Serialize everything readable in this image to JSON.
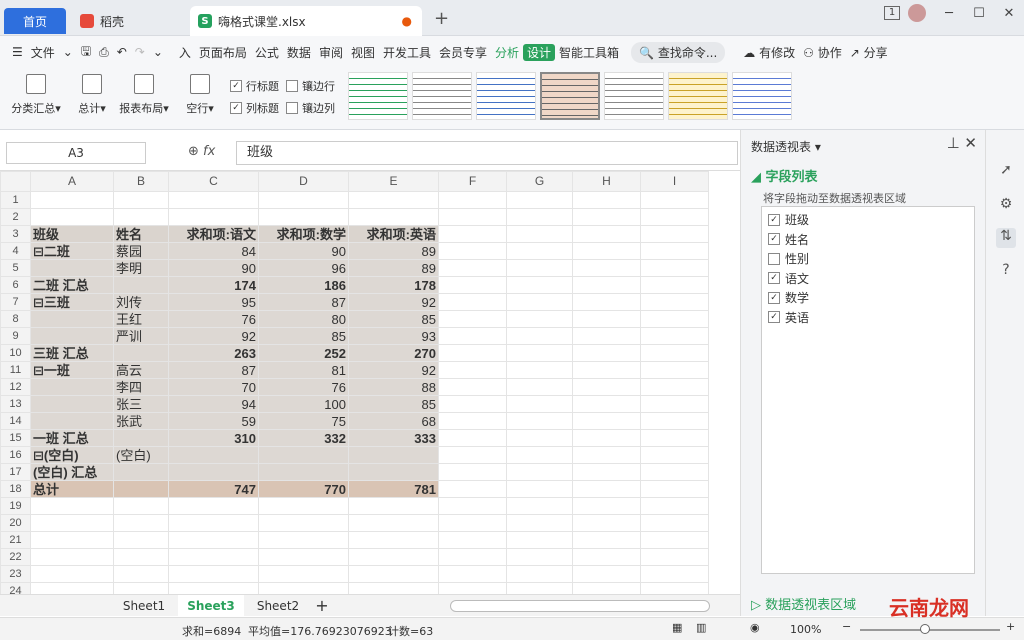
{
  "tabs": {
    "home": "首页",
    "daoke": "稻壳",
    "file": "嗨格式课堂.xlsx"
  },
  "window": {
    "page_indicator": "1"
  },
  "menu": [
    "文件",
    "入",
    "页面布局",
    "公式",
    "数据",
    "审阅",
    "视图",
    "开发工具",
    "会员专享",
    "分析",
    "设计",
    "智能工具箱"
  ],
  "menu_right": {
    "search": "查找命令...",
    "modified": "有修改",
    "collab": "协作",
    "share": "分享"
  },
  "ribbon": {
    "buttons": [
      "分类汇总",
      "总计",
      "报表布局",
      "空行"
    ],
    "checks": [
      {
        "label": "行标题",
        "checked": true
      },
      {
        "label": "镶边行",
        "checked": false
      },
      {
        "label": "列标题",
        "checked": true
      },
      {
        "label": "镶边列",
        "checked": false
      }
    ]
  },
  "formula": {
    "name_box": "A3",
    "fx": "fx",
    "value": "班级"
  },
  "columns": [
    "A",
    "B",
    "C",
    "D",
    "E",
    "F",
    "G",
    "H",
    "I"
  ],
  "rows": [
    {
      "n": "1",
      "c": [
        "",
        "",
        "",
        "",
        ""
      ],
      "t": "blank"
    },
    {
      "n": "2",
      "c": [
        "",
        "",
        "",
        "",
        ""
      ],
      "t": "blank"
    },
    {
      "n": "3",
      "c": [
        "班级",
        "姓名",
        "求和项:语文",
        "求和项:数学",
        "求和项:英语"
      ],
      "t": "header"
    },
    {
      "n": "4",
      "c": [
        "⊟二班",
        "蔡园",
        "84",
        "90",
        "89"
      ],
      "t": "data"
    },
    {
      "n": "5",
      "c": [
        "",
        "李明",
        "90",
        "96",
        "89"
      ],
      "t": "data"
    },
    {
      "n": "6",
      "c": [
        "二班 汇总",
        "",
        "174",
        "186",
        "178"
      ],
      "t": "sub"
    },
    {
      "n": "7",
      "c": [
        "⊟三班",
        "刘传",
        "95",
        "87",
        "92"
      ],
      "t": "data"
    },
    {
      "n": "8",
      "c": [
        "",
        "王红",
        "76",
        "80",
        "85"
      ],
      "t": "data"
    },
    {
      "n": "9",
      "c": [
        "",
        "严训",
        "92",
        "85",
        "93"
      ],
      "t": "data"
    },
    {
      "n": "10",
      "c": [
        "三班 汇总",
        "",
        "263",
        "252",
        "270"
      ],
      "t": "sub"
    },
    {
      "n": "11",
      "c": [
        "⊟一班",
        "高云",
        "87",
        "81",
        "92"
      ],
      "t": "data"
    },
    {
      "n": "12",
      "c": [
        "",
        "李四",
        "70",
        "76",
        "88"
      ],
      "t": "data"
    },
    {
      "n": "13",
      "c": [
        "",
        "张三",
        "94",
        "100",
        "85"
      ],
      "t": "data"
    },
    {
      "n": "14",
      "c": [
        "",
        "张武",
        "59",
        "75",
        "68"
      ],
      "t": "data"
    },
    {
      "n": "15",
      "c": [
        "一班 汇总",
        "",
        "310",
        "332",
        "333"
      ],
      "t": "sub"
    },
    {
      "n": "16",
      "c": [
        "⊟(空白)",
        "(空白)",
        "",
        "",
        ""
      ],
      "t": "data"
    },
    {
      "n": "17",
      "c": [
        "(空白) 汇总",
        "",
        "",
        "",
        ""
      ],
      "t": "sub"
    },
    {
      "n": "18",
      "c": [
        "总计",
        "",
        "747",
        "770",
        "781"
      ],
      "t": "tot"
    },
    {
      "n": "19",
      "c": [
        "",
        "",
        "",
        "",
        ""
      ],
      "t": "blank"
    },
    {
      "n": "20",
      "c": [
        "",
        "",
        "",
        "",
        ""
      ],
      "t": "blank"
    },
    {
      "n": "21",
      "c": [
        "",
        "",
        "",
        "",
        ""
      ],
      "t": "blank"
    },
    {
      "n": "22",
      "c": [
        "",
        "",
        "",
        "",
        ""
      ],
      "t": "blank"
    },
    {
      "n": "23",
      "c": [
        "",
        "",
        "",
        "",
        ""
      ],
      "t": "blank"
    },
    {
      "n": "24",
      "c": [
        "",
        "",
        "",
        "",
        ""
      ],
      "t": "blank"
    }
  ],
  "sheets": [
    "Sheet1",
    "Sheet3",
    "Sheet2"
  ],
  "active_sheet": "Sheet3",
  "status": {
    "sum": "求和=6894",
    "avg": "平均值=176.76923076923",
    "count": "计数=63",
    "zoom": "100%"
  },
  "panel": {
    "title": "数据透视表",
    "section": "字段列表",
    "hint": "将字段拖动至数据透视表区域",
    "fields": [
      {
        "name": "班级",
        "checked": true
      },
      {
        "name": "姓名",
        "checked": true
      },
      {
        "name": "性别",
        "checked": false
      },
      {
        "name": "语文",
        "checked": true
      },
      {
        "name": "数学",
        "checked": true
      },
      {
        "name": "英语",
        "checked": true
      }
    ],
    "footer": "数据透视表区域"
  },
  "watermark": "云南龙网"
}
